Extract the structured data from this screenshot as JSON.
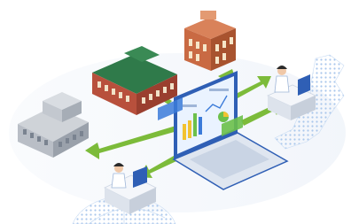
{
  "illustration": {
    "kind": "network-diagram",
    "nodes": [
      {
        "id": "laptop",
        "role": "central-hub",
        "icon": "laptop-dashboard-icon"
      },
      {
        "id": "building-grey",
        "role": "facility",
        "icon": "grey-building-icon"
      },
      {
        "id": "building-green-roof",
        "role": "facility",
        "icon": "green-roof-building-icon"
      },
      {
        "id": "building-orange",
        "role": "facility",
        "icon": "orange-building-icon"
      },
      {
        "id": "worker-map",
        "role": "remote-user",
        "icon": "worker-desk-icon"
      },
      {
        "id": "worker-globe",
        "role": "remote-user",
        "icon": "worker-desk-icon"
      }
    ],
    "colors": {
      "arrow": "#7cbb3a",
      "arrow_dark": "#5a9a25",
      "laptop_frame": "#2f5fb5",
      "screen": "#eaf3ff",
      "chart_yellow": "#f2c230",
      "chart_green": "#6cc04a",
      "chart_blue": "#3b7bd9",
      "map_dots": "#aac7ec",
      "background": "#ffffff"
    }
  }
}
